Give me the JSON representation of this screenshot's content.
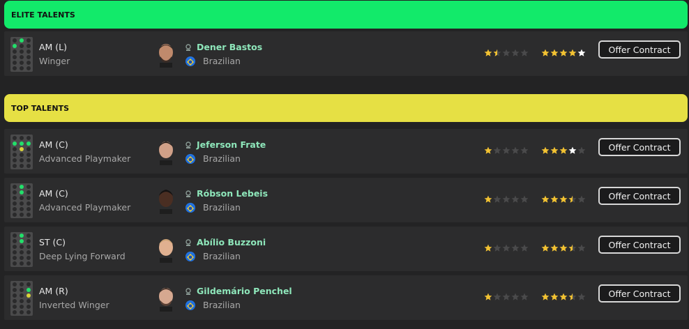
{
  "sections": {
    "elite": {
      "title": "ELITE TALENTS"
    },
    "top": {
      "title": "TOP TALENTS"
    }
  },
  "colors": {
    "elite_header": "#12ea6a",
    "top_header": "#e6e044",
    "player_name": "#8ee6ba",
    "star_gold": "#f2c232",
    "star_white": "#ffffff",
    "star_empty": "#4a4a4b"
  },
  "players": [
    {
      "position": "AM (L)",
      "role": "Winger",
      "name": "Dener Bastos",
      "nationality": "Brazilian",
      "current_ability_stars": 1.5,
      "potential_ability_stars": 4,
      "potential_extra_white_star": true,
      "action_label": "Offer Contract"
    },
    {
      "position": "AM (C)",
      "role": "Advanced Playmaker",
      "name": "Jeferson Frate",
      "nationality": "Brazilian",
      "current_ability_stars": 1,
      "potential_ability_stars": 3,
      "potential_extra_white_star": true,
      "action_label": "Offer Contract"
    },
    {
      "position": "AM (C)",
      "role": "Advanced Playmaker",
      "name": "Róbson Lebeis",
      "nationality": "Brazilian",
      "current_ability_stars": 1,
      "potential_ability_stars": 3.5,
      "potential_extra_white_star": false,
      "action_label": "Offer Contract"
    },
    {
      "position": "ST (C)",
      "role": "Deep Lying Forward",
      "name": "Abílio Buzzoni",
      "nationality": "Brazilian",
      "current_ability_stars": 1,
      "potential_ability_stars": 3.5,
      "potential_extra_white_star": false,
      "action_label": "Offer Contract"
    },
    {
      "position": "AM (R)",
      "role": "Inverted Winger",
      "name": "Gildemário Penchel",
      "nationality": "Brazilian",
      "current_ability_stars": 1,
      "potential_ability_stars": 3.5,
      "potential_extra_white_star": false,
      "action_label": "Offer Contract"
    }
  ],
  "icons": {
    "position_pitch": "pitch-position-icon",
    "shortlist_pin": "scout-pin-icon",
    "flag": "brazil-flag-icon",
    "star": "star-icon",
    "face": "player-face-icon"
  }
}
